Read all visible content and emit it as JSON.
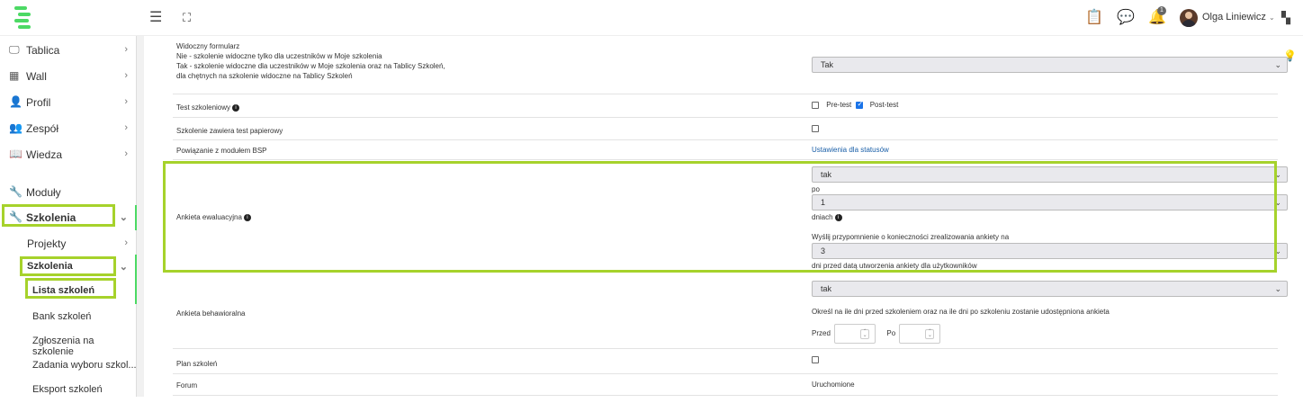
{
  "header": {
    "user_name": "Olga Liniewicz",
    "notification_count": "1",
    "icons": [
      "menu-icon",
      "fullscreen-icon",
      "clipboard-icon",
      "chat-icon",
      "bell-icon",
      "apps-icon"
    ]
  },
  "sidebar": {
    "items": [
      {
        "label": "Tablica",
        "icon": "monitor-icon"
      },
      {
        "label": "Wall",
        "icon": "wall-icon"
      },
      {
        "label": "Profil",
        "icon": "user-icon"
      },
      {
        "label": "Zespół",
        "icon": "team-icon"
      },
      {
        "label": "Wiedza",
        "icon": "book-icon"
      },
      {
        "label": "Moduły",
        "icon": "wrench-icon"
      },
      {
        "label": "Szkolenia",
        "icon": "wrench-icon"
      }
    ],
    "sub": {
      "projekty": "Projekty",
      "szkolenia": "Szkolenia",
      "lista": "Lista szkoleń",
      "bank": "Bank szkoleń",
      "zgloszenia": "Zgłoszenia na szkolenie",
      "zadania": "Zadania wyboru szkol...",
      "eksport": "Eksport szkoleń"
    }
  },
  "form": {
    "visible_label_1": "Widoczny formularz",
    "visible_label_2": "Nie - szkolenie widoczne tylko dla uczestników w Moje szkolenia",
    "visible_label_3": "Tak - szkolenie widoczne dla uczestników w Moje szkolenia oraz na Tablicy Szkoleń,",
    "visible_label_4": "dla chętnych na szkolenie widoczne na Tablicy Szkoleń",
    "visible_value": "Tak",
    "test_label": "Test szkoleniowy",
    "pretest_label": "Pre-test",
    "posttest_label": "Post-test",
    "paper_label": "Szkolenie zawiera test papierowy",
    "bsp_label": "Powiązanie z modułem BSP",
    "bsp_link": "Ustawienia dla statusów",
    "eval_label": "Ankieta ewaluacyjna",
    "eval_value": "tak",
    "po_label": "po",
    "po_value": "1",
    "days_label": "dniach",
    "reminder_label": "Wyślij przypomnienie o konieczności zrealizowania ankiety na",
    "reminder_value": "3",
    "reminder_suffix": "dni przed datą utworzenia ankiety dla użytkowników",
    "behav_label": "Ankieta behawioralna",
    "behav_value": "tak",
    "behav_desc": "Określ na ile dni przed szkoleniem oraz na ile dni po szkoleniu zostanie udostępniona ankieta",
    "przed_label": "Przed",
    "po2_label": "Po",
    "plan_label": "Plan szkoleń",
    "forum_label": "Forum",
    "forum_value": "Uruchomione"
  },
  "colors": {
    "accent": "#4cd964",
    "highlight": "#a6d22b",
    "link": "#1a5fa8"
  }
}
